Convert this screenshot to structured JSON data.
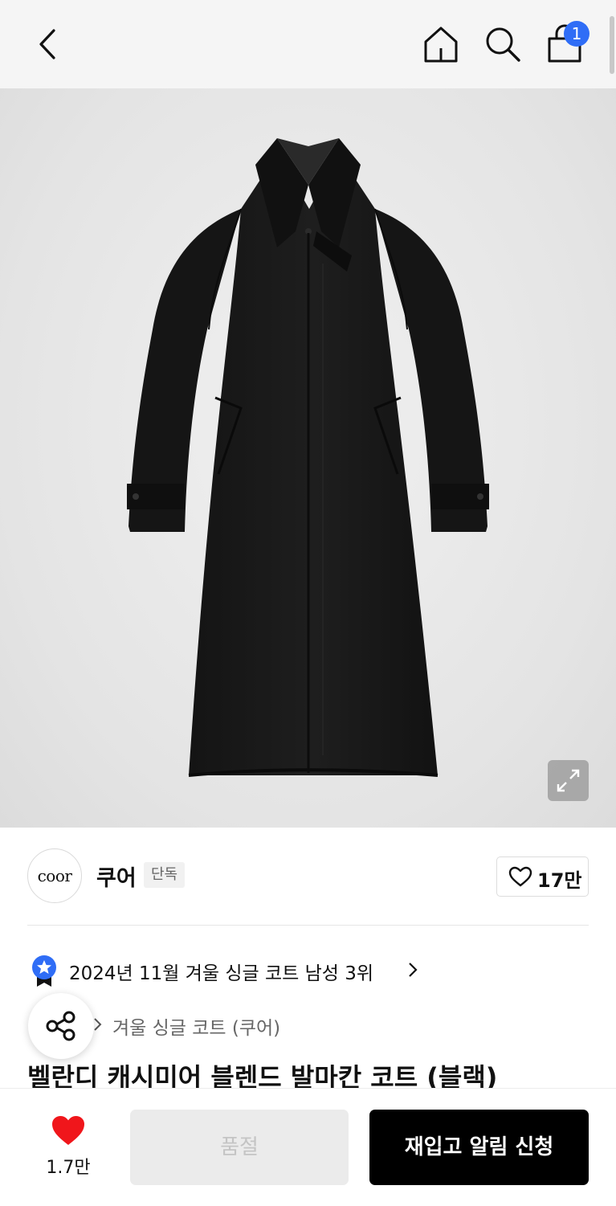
{
  "topbar": {
    "back_icon": "chevron-left-icon",
    "home_icon": "home-icon",
    "search_icon": "search-icon",
    "bag_icon": "shopping-bag-icon",
    "cart_count": "1"
  },
  "gallery": {
    "expand_icon": "expand-icon"
  },
  "brand": {
    "logo_text": "coor",
    "name": "쿠어",
    "tag": "단독",
    "like_count": "17만"
  },
  "ranking": {
    "text": "2024년 11월 겨울 싱글 코트 남성 3위"
  },
  "category": {
    "text": "겨울 싱글 코트 (쿠어)"
  },
  "product": {
    "title": "벨란디 캐시미어 블렌드 발마칸 코트 (블랙)"
  },
  "bottom": {
    "wish_count": "1.7만",
    "soldout_label": "품절",
    "restock_label": "재입고 알림 신청"
  },
  "colors": {
    "accent_blue": "#2f6df6",
    "heart_red": "#f0161b",
    "primary_black": "#000000"
  }
}
